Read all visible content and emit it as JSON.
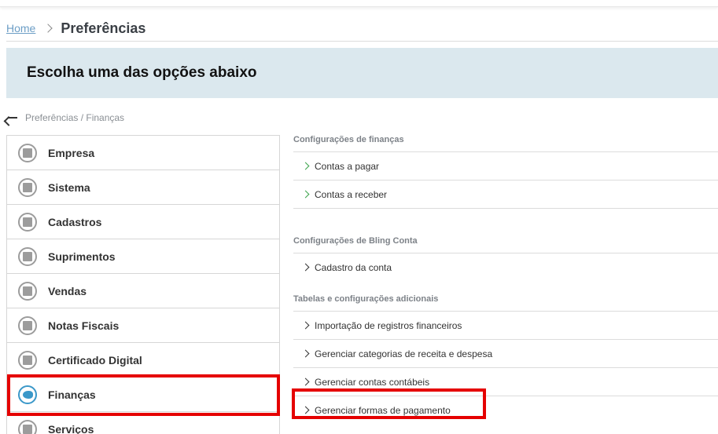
{
  "breadcrumb": {
    "home": "Home",
    "title": "Preferências"
  },
  "banner": {
    "heading": "Escolha uma das opções abaixo"
  },
  "subnav": {
    "path": "Preferências / Finanças"
  },
  "menu": {
    "items": [
      {
        "label": "Empresa",
        "icon": "building-icon"
      },
      {
        "label": "Sistema",
        "icon": "monitor-icon"
      },
      {
        "label": "Cadastros",
        "icon": "book-icon"
      },
      {
        "label": "Suprimentos",
        "icon": "box-icon"
      },
      {
        "label": "Vendas",
        "icon": "users-icon"
      },
      {
        "label": "Notas Fiscais",
        "icon": "invoice-icon"
      },
      {
        "label": "Certificado Digital",
        "icon": "certificate-icon"
      },
      {
        "label": "Finanças",
        "icon": "piggy-bank-icon",
        "active": true
      },
      {
        "label": "Serviços",
        "icon": "tools-icon"
      }
    ]
  },
  "sections": {
    "finance": {
      "title": "Configurações de finanças",
      "links": [
        "Contas a pagar",
        "Contas a receber"
      ]
    },
    "bling": {
      "title": "Configurações de Bling Conta",
      "links": [
        "Cadastro da conta"
      ]
    },
    "tables": {
      "title": "Tabelas e configurações adicionais",
      "links": [
        "Importação de registros financeiros",
        "Gerenciar categorias de receita e despesa",
        "Gerenciar contas contábeis",
        "Gerenciar formas de pagamento"
      ]
    }
  },
  "colors": {
    "accent": "#3b98c9",
    "highlight": "#e50000",
    "banner": "#dbe8ee",
    "link_home": "#6c9ec6",
    "chevron_green": "#3aa34a"
  }
}
